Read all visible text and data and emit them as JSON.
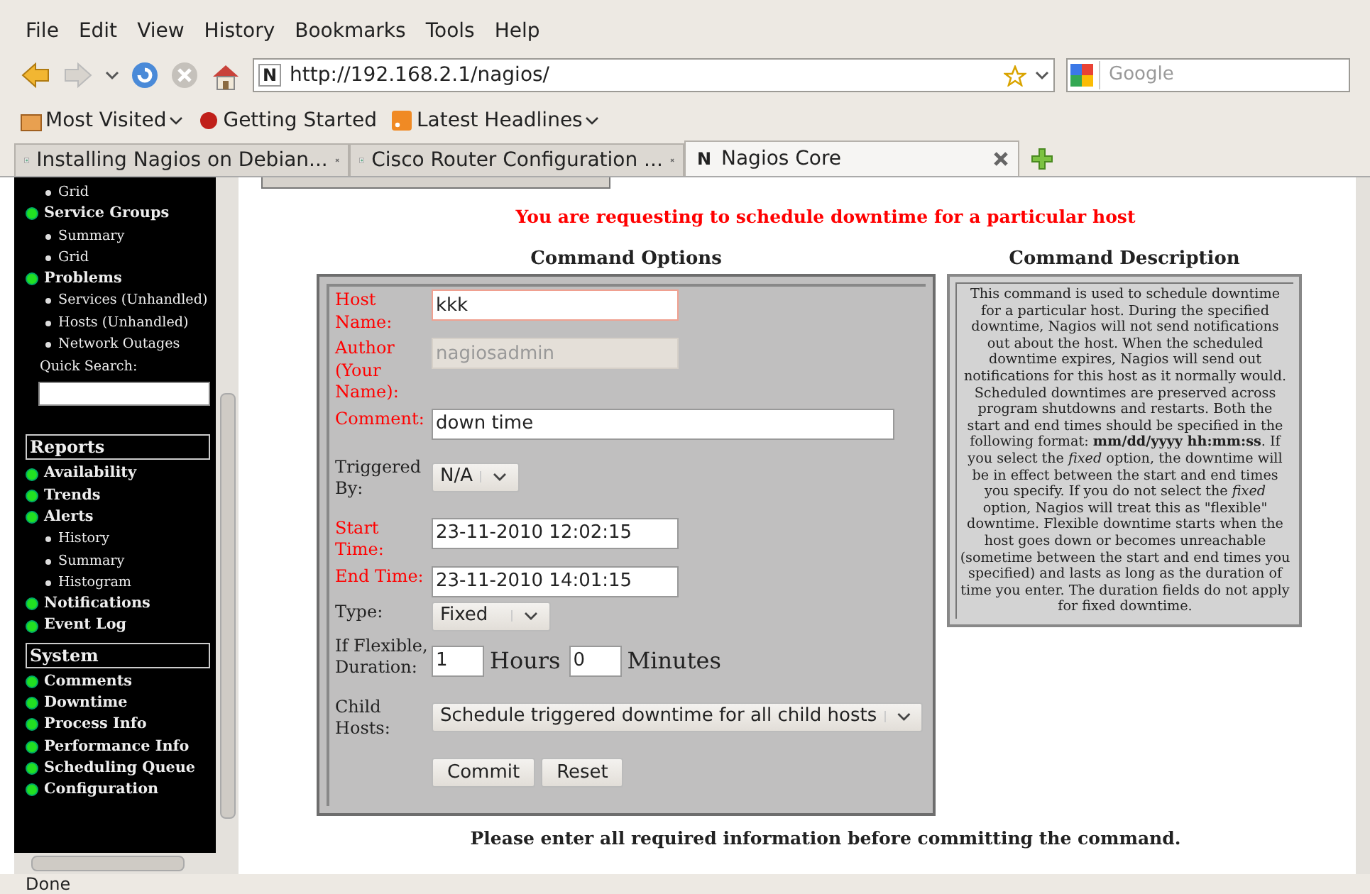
{
  "menu_bar": [
    "File",
    "Edit",
    "View",
    "History",
    "Bookmarks",
    "Tools",
    "Help"
  ],
  "address_bar": {
    "site_icon": "N",
    "value": "http://192.168.2.1/nagios/"
  },
  "search": {
    "placeholder": "Google"
  },
  "bookmarks": [
    {
      "label": "Most Visited",
      "dropdown": true
    },
    {
      "label": "Getting Started",
      "dropdown": false
    },
    {
      "label": "Latest Headlines",
      "dropdown": true
    }
  ],
  "tabs": [
    {
      "label": "Installing Nagios on Debian...",
      "selected": false
    },
    {
      "label": "Cisco Router Configuration ...",
      "selected": false
    },
    {
      "label": "Nagios Core",
      "selected": true,
      "site_icon": "N"
    }
  ],
  "sidebar": {
    "items": [
      {
        "kind": "sub",
        "label": "Grid"
      },
      {
        "kind": "section",
        "label": "Service Groups"
      },
      {
        "kind": "sub",
        "label": "Summary"
      },
      {
        "kind": "sub",
        "label": "Grid"
      },
      {
        "kind": "section",
        "label": "Problems"
      },
      {
        "kind": "sub",
        "label": "Services (Unhandled)"
      },
      {
        "kind": "sub",
        "label": "Hosts (Unhandled)"
      },
      {
        "kind": "sub",
        "label": "Network Outages"
      },
      {
        "kind": "search",
        "label": "Quick Search:"
      },
      {
        "kind": "header",
        "label": "Reports"
      },
      {
        "kind": "section",
        "label": "Availability"
      },
      {
        "kind": "section",
        "label": "Trends"
      },
      {
        "kind": "section",
        "label": "Alerts"
      },
      {
        "kind": "sub",
        "label": "History"
      },
      {
        "kind": "sub",
        "label": "Summary"
      },
      {
        "kind": "sub",
        "label": "Histogram"
      },
      {
        "kind": "section",
        "label": "Notifications"
      },
      {
        "kind": "section",
        "label": "Event Log"
      },
      {
        "kind": "header",
        "label": "System"
      },
      {
        "kind": "section",
        "label": "Comments"
      },
      {
        "kind": "section",
        "label": "Downtime"
      },
      {
        "kind": "section",
        "label": "Process Info"
      },
      {
        "kind": "section",
        "label": "Performance Info"
      },
      {
        "kind": "section",
        "label": "Scheduling Queue"
      },
      {
        "kind": "section",
        "label": "Configuration"
      }
    ]
  },
  "page_title": "You are requesting to schedule downtime for a particular host",
  "command_options": {
    "title": "Command Options",
    "rows": [
      {
        "kind": "text",
        "label": "Host Name:",
        "required": true,
        "value": "kkk",
        "focused": true,
        "wide": false
      },
      {
        "kind": "text",
        "label": "Author (Your Name):",
        "required": true,
        "value": "nagiosadmin",
        "disabled": true,
        "wide": false
      },
      {
        "kind": "text",
        "label": "Comment:",
        "required": true,
        "value": "down time",
        "wide": true
      },
      {
        "kind": "select",
        "label": "Triggered By:",
        "required": false,
        "value": "N/A"
      },
      {
        "kind": "text",
        "label": "Start Time:",
        "required": true,
        "value": "23-11-2010 12:02:15",
        "wide": false
      },
      {
        "kind": "text",
        "label": "End Time:",
        "required": true,
        "value": "23-11-2010 14:01:15",
        "wide": false
      },
      {
        "kind": "select",
        "label": "Type:",
        "required": false,
        "value": "Fixed"
      },
      {
        "kind": "duration",
        "label": "If Flexible, Duration:",
        "required": false,
        "hours": "1",
        "hours_label": "Hours",
        "minutes": "0",
        "minutes_label": "Minutes"
      },
      {
        "kind": "select",
        "label": "Child Hosts:",
        "required": false,
        "value": "Schedule triggered downtime for all child hosts",
        "wide": true
      },
      {
        "kind": "buttons",
        "buttons": [
          "Commit",
          "Reset"
        ]
      }
    ]
  },
  "command_description": {
    "title": "Command Description",
    "text": "This command is used to schedule downtime for a particular host. During the specified downtime, Nagios will not send notifications out about the host. When the scheduled downtime expires, Nagios will send out notifications for this host as it normally would. Scheduled downtimes are preserved across program shutdowns and restarts. Both the start and end times should be specified in the following format: **mm/dd/yyyy hh:mm:ss**. If you select the *fixed* option, the downtime will be in effect between the start and end times you specify. If you do not select the *fixed* option, Nagios will treat this as \"flexible\" downtime. Flexible downtime starts when the host goes down or becomes unreachable (sometime between the start and end times you specified) and lasts as long as the duration of time you enter. The duration fields do not apply for fixed downtime."
  },
  "footer_note": "Please enter all required information before committing the command.",
  "status_bar": "Done"
}
